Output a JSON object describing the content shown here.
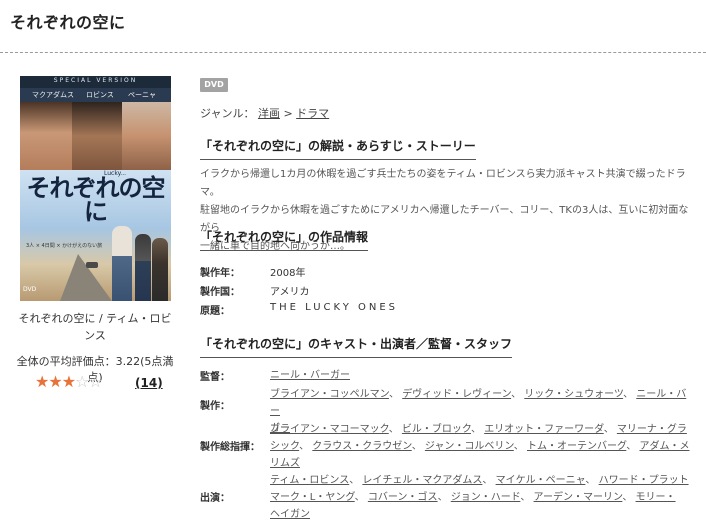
{
  "page_title": "それぞれの空に",
  "poster": {
    "top_band": "SPECIAL VERSION",
    "names": [
      "マクアダムス",
      "ロビンス",
      "ペーニャ"
    ],
    "title": "それぞれの空に",
    "lucky": "Lucky...",
    "tagline": "3人 × 4日間 × かけがえのない旅",
    "dvd_mark": "DVD"
  },
  "left_caption": "それぞれの空に / ティム・ロビンス",
  "rating": {
    "label": "全体の平均評価点：3.22(5点満点)",
    "value": 3.22,
    "max": 5,
    "stars_full": "★★★",
    "stars_empty": "☆☆",
    "review_count": "14"
  },
  "badge": "DVD",
  "genre": {
    "label": "ジャンル：",
    "primary": "洋画",
    "separator": ">",
    "secondary": "ドラマ"
  },
  "synopsis_section": {
    "title": "「それぞれの空に」の解説・あらすじ・ストーリー",
    "lines": [
      "イラクから帰還し1カ月の休暇を過ごす兵士たちの姿をティム・ロビンスら実力派キャスト共演で綴ったドラマ。",
      "駐留地のイラクから休暇を過ごすためにアメリカへ帰還したチーバー、コリー、TKの3人は、互いに初対面ながら",
      "一緒に車で目的地へ向かうが…。"
    ]
  },
  "info_section": {
    "title": "「それぞれの空に」の作品情報",
    "rows": [
      {
        "label": "製作年：",
        "value": "2008年"
      },
      {
        "label": "製作国：",
        "value": "アメリカ"
      },
      {
        "label": "原題：",
        "value": "THE LUCKY ONES"
      }
    ]
  },
  "cast_section": {
    "title": "「それぞれの空に」のキャスト・出演者／監督・スタッフ",
    "rows": [
      {
        "label": "監督：",
        "lines": [
          [
            "ニール・バーガー"
          ]
        ]
      },
      {
        "label": "製作：",
        "lines": [
          [
            "ブライアン・コッペルマン",
            "デヴィッド・レヴィーン",
            "リック・シュウォーツ",
            "ニール・バー"
          ],
          [
            "ガー"
          ]
        ]
      },
      {
        "label": "製作総指揮：",
        "lines": [
          [
            "ブライアン・マコーマック",
            "ビル・ブロック",
            "エリオット・ファーワーダ",
            "マリーナ・グラ"
          ],
          [
            "シック",
            "クラウス・クラウゼン",
            "ジャン・コルベリン",
            "トム・オーテンバーグ",
            "アダム・メ"
          ],
          [
            "リムズ"
          ]
        ]
      },
      {
        "label": "出演：",
        "lines": [
          [
            "ティム・ロビンス",
            "レイチェル・マクアダムス",
            "マイケル・ペーニャ",
            "ハワード・プラット"
          ],
          [
            "マーク・L・ヤング",
            "コバーン・ゴス",
            "ジョン・ハード",
            "アーデン・マーリン",
            "モリー・"
          ],
          [
            "ヘイガン"
          ]
        ]
      }
    ]
  }
}
